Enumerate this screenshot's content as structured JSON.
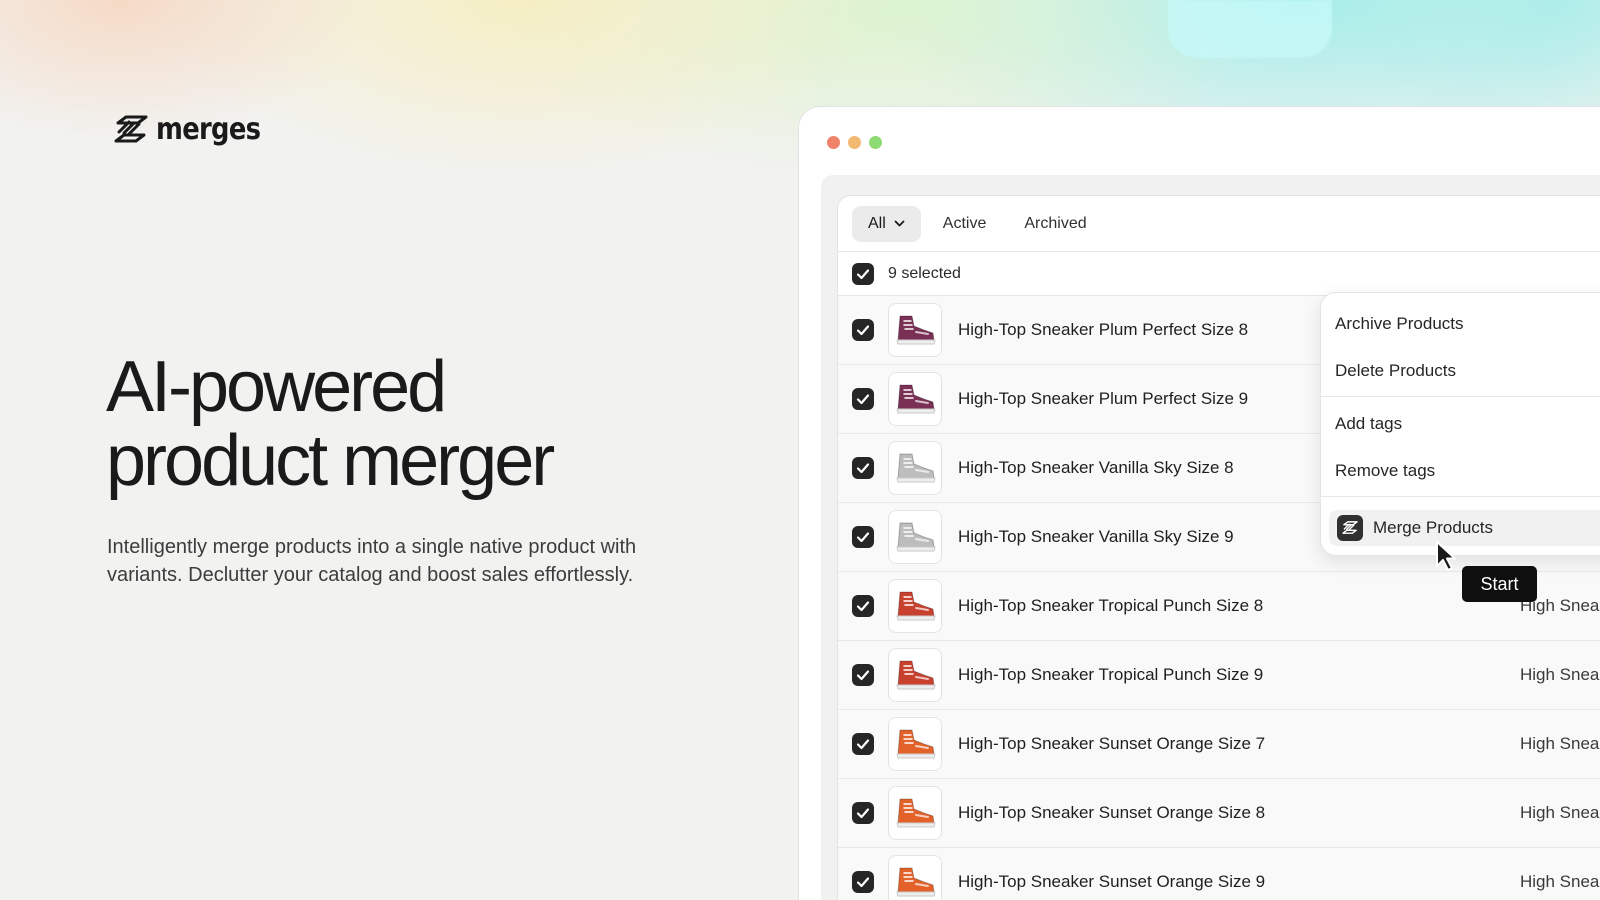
{
  "brand": {
    "name": "merges"
  },
  "hero": {
    "headline_line1": "AI-powered",
    "headline_line2": "product merger",
    "subcopy": "Intelligently merge products into a single native product with variants. Declutter your catalog and boost sales effortlessly."
  },
  "colors": {
    "checkbox": "#262626",
    "tooltip": "#0f0f0f",
    "window_red": "#f0826a",
    "window_yellow": "#f3b871",
    "window_green": "#8edb74"
  },
  "tabs": [
    {
      "label": "All",
      "icon": "chevron-down-icon",
      "active": true
    },
    {
      "label": "Active",
      "active": false
    },
    {
      "label": "Archived",
      "active": false
    }
  ],
  "selection": {
    "label": "9 selected"
  },
  "products": [
    {
      "name": "High-Top Sneaker Plum Perfect Size 8",
      "trail": "",
      "color": "#7a2f55",
      "icon": "sneaker-thumbnail"
    },
    {
      "name": "High-Top Sneaker Plum Perfect Size 9",
      "trail": "",
      "color": "#7a2f55",
      "icon": "sneaker-thumbnail"
    },
    {
      "name": "High-Top Sneaker Vanilla Sky Size 8",
      "trail": "",
      "color": "#bdbdbd",
      "icon": "sneaker-thumbnail"
    },
    {
      "name": "High-Top Sneaker Vanilla Sky Size 9",
      "trail": "",
      "color": "#bdbdbd",
      "icon": "sneaker-thumbnail"
    },
    {
      "name": "High-Top Sneaker Tropical Punch Size 8",
      "trail": "High Snea",
      "color": "#c8402e",
      "icon": "sneaker-thumbnail"
    },
    {
      "name": "High-Top Sneaker Tropical Punch Size 9",
      "trail": "High Snea",
      "color": "#c8402e",
      "icon": "sneaker-thumbnail"
    },
    {
      "name": "High-Top Sneaker Sunset Orange Size 7",
      "trail": "High Snea",
      "color": "#e2622a",
      "icon": "sneaker-thumbnail"
    },
    {
      "name": "High-Top Sneaker Sunset Orange Size 8",
      "trail": "High Snea",
      "color": "#e2622a",
      "icon": "sneaker-thumbnail"
    },
    {
      "name": "High-Top Sneaker Sunset Orange Size 9",
      "trail": "High Snea",
      "color": "#e2622a",
      "icon": "sneaker-thumbnail"
    }
  ],
  "menu": {
    "archive": "Archive Products",
    "delete": "Delete Products",
    "add_tags": "Add tags",
    "remove_tags": "Remove tags",
    "merge": "Merge Products"
  },
  "tooltip": {
    "label": "Start"
  }
}
